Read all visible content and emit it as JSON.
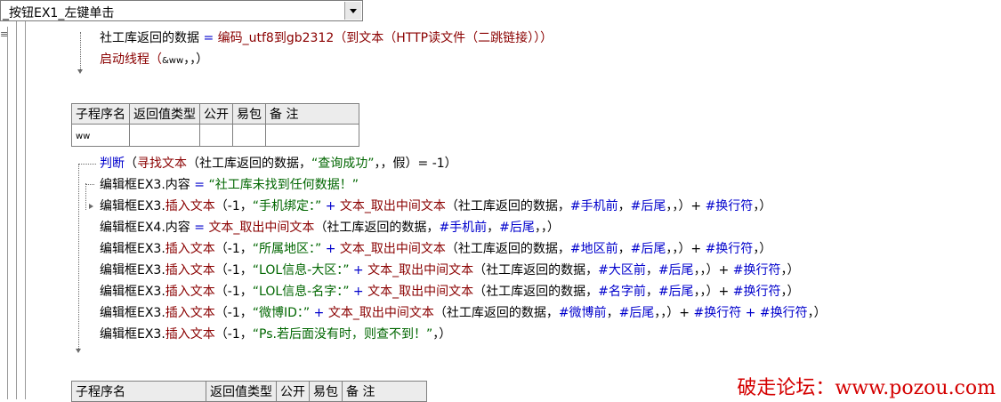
{
  "selector": {
    "value": "_按钮EX1_左键单击"
  },
  "gutter_mark": "≡",
  "block1": {
    "line1": {
      "a": "社工库返回的数据",
      "op": " = ",
      "f": "编码_utf8到gb2312",
      "b": "（到文本（HTTP读文件（二跳链接）））"
    },
    "line2": {
      "f": "启动线程",
      "b": "（",
      "arg": "&ww",
      "c": "，，）"
    }
  },
  "table1": {
    "headers": [
      "子程序名",
      "返回值类型",
      "公开",
      "易包",
      "备 注"
    ],
    "row": [
      "ww",
      "",
      "",
      "",
      ""
    ]
  },
  "block2": [
    {
      "pre": "判断",
      "pre_class": "func",
      "rest1": "（",
      "f": "寻找文本",
      "rest2": "（社工库返回的数据，",
      "s": "“查询成功”",
      "rest3": "，，假）= -1）"
    },
    {
      "pre": "编辑框EX3.",
      "pre_class": "ink",
      "f": "内容",
      "rest1": " = ",
      "s": "“社工库未找到任何数据！”"
    },
    {
      "pre": "编辑框EX3.",
      "f": "插入文本",
      "rest1": "（-1，",
      "s": "“手机绑定：”",
      "rest2": " + ",
      "f2": "文本_取出中间文本",
      "rest3": "（社工库返回的数据，",
      "v1": "#手机前",
      "sep": "，",
      "v2": "#后尾",
      "rest4": "，，）+ ",
      "v3": "#换行符",
      "end": "，）"
    },
    {
      "pre": "编辑框EX4.",
      "f": "内容",
      "rest1": " = ",
      "f2": "文本_取出中间文本",
      "rest3": "（社工库返回的数据，",
      "v1": "#手机前",
      "sep": "，",
      "v2": "#后尾",
      "rest4": "，，）"
    },
    {
      "pre": "编辑框EX3.",
      "f": "插入文本",
      "rest1": "（-1，",
      "s": "“所属地区：”",
      "rest2": " + ",
      "f2": "文本_取出中间文本",
      "rest3": "（社工库返回的数据，",
      "v1": "#地区前",
      "sep": "，",
      "v2": "#后尾",
      "rest4": "，，）+ ",
      "v3": "#换行符",
      "end": "，）"
    },
    {
      "pre": "编辑框EX3.",
      "f": "插入文本",
      "rest1": "（-1，",
      "s": "“LOL信息-大区：”",
      "rest2": " + ",
      "f2": "文本_取出中间文本",
      "rest3": "（社工库返回的数据，",
      "v1": "#大区前",
      "sep": "，",
      "v2": "#后尾",
      "rest4": "，，）+ ",
      "v3": "#换行符",
      "end": "，）"
    },
    {
      "pre": "编辑框EX3.",
      "f": "插入文本",
      "rest1": "（-1，",
      "s": "“LOL信息-名字：”",
      "rest2": " + ",
      "f2": "文本_取出中间文本",
      "rest3": "（社工库返回的数据，",
      "v1": "#名字前",
      "sep": "，",
      "v2": "#后尾",
      "rest4": "，，）+ ",
      "v3": "#换行符",
      "end": "，）"
    },
    {
      "pre": "编辑框EX3.",
      "f": "插入文本",
      "rest1": "（-1，",
      "s": "“微博ID：”",
      "rest2": " + ",
      "f2": "文本_取出中间文本",
      "rest3": "（社工库返回的数据，",
      "v1": "#微博前",
      "sep": "，",
      "v2": "#后尾",
      "rest4": "，，）+ ",
      "v3": "#换行符 + #换行符",
      "end": "，）"
    },
    {
      "pre": "编辑框EX3.",
      "f": "插入文本",
      "rest1": "（-1，",
      "s": "“Ps.若后面没有时，则查不到！”",
      "end": "，）"
    }
  ],
  "table2": {
    "headers": [
      "子程序名",
      "返回值类型",
      "公开",
      "易包",
      "备 注"
    ]
  },
  "watermark": "破走论坛：www.pozou.com"
}
